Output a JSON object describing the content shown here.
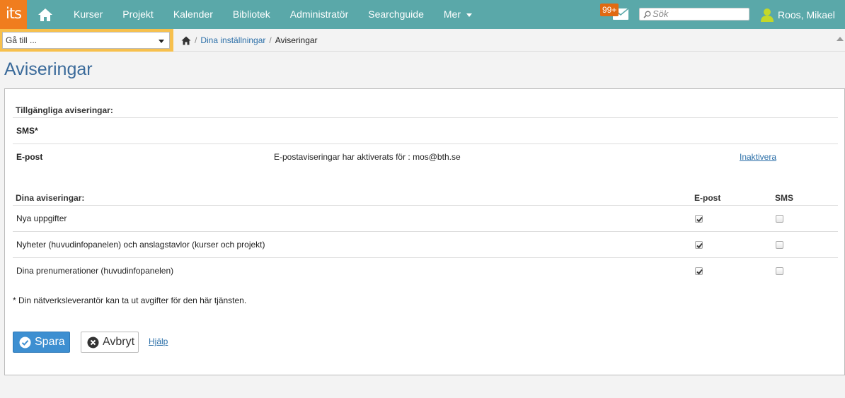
{
  "app": {
    "logo_text": "its"
  },
  "nav": {
    "items": [
      "Kurser",
      "Projekt",
      "Kalender",
      "Bibliotek",
      "Administratör",
      "Searchguide"
    ],
    "more_label": "Mer"
  },
  "header": {
    "messages_badge": "99+",
    "search_placeholder": "Sök",
    "user_name": "Roos, Mikael"
  },
  "goto": {
    "label": "Gå till ..."
  },
  "breadcrumb": {
    "parent": "Dina inställningar",
    "current": "Aviseringar"
  },
  "page": {
    "title": "Aviseringar"
  },
  "available": {
    "header": "Tillgängliga aviseringar:",
    "sms_label": "SMS*",
    "email_label": "E-post",
    "email_status": "E-postaviseringar har aktiverats för : mos@bth.se",
    "email_action": "Inaktivera"
  },
  "mine": {
    "header": "Dina aviseringar:",
    "col_email": "E-post",
    "col_sms": "SMS",
    "rows": [
      {
        "label": "Nya uppgifter",
        "email": true,
        "sms": false
      },
      {
        "label": "Nyheter (huvudinfopanelen) och anslagstavlor (kurser och projekt)",
        "email": true,
        "sms": false
      },
      {
        "label": "Dina prenumerationer (huvudinfopanelen)",
        "email": true,
        "sms": false
      }
    ]
  },
  "footnote": "* Din nätverksleverantör kan ta ut avgifter för den här tjänsten.",
  "actions": {
    "save": "Spara",
    "cancel": "Avbryt",
    "help": "Hjälp"
  },
  "colors": {
    "topbar": "#5aa8a9",
    "logo": "#f07d1e",
    "primary_button": "#3d8fd1",
    "title": "#3a6a9a",
    "link": "#2b6fa8"
  }
}
